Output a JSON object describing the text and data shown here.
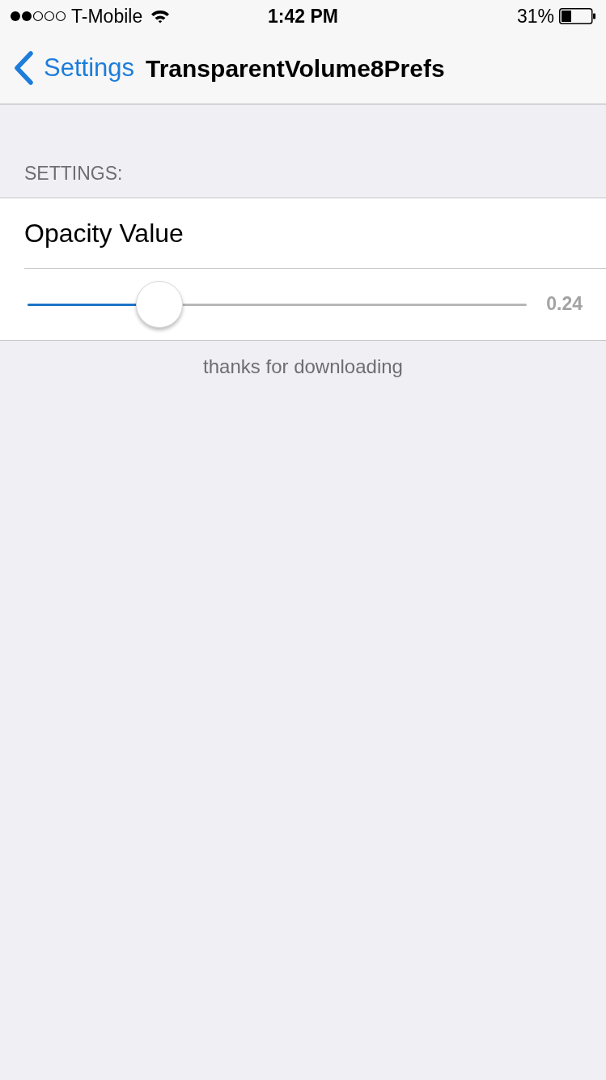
{
  "status_bar": {
    "carrier": "T-Mobile",
    "time": "1:42 PM",
    "battery": "31%"
  },
  "nav_bar": {
    "back_label": "Settings",
    "title": "TransparentVolume8Prefs"
  },
  "section": {
    "header": "SETTINGS:",
    "rows": [
      {
        "kind": "label",
        "label": "Opacity Value"
      },
      {
        "kind": "slider",
        "level": 0.24,
        "reading": "0.24"
      }
    ],
    "footer": "thanks for downloading"
  }
}
